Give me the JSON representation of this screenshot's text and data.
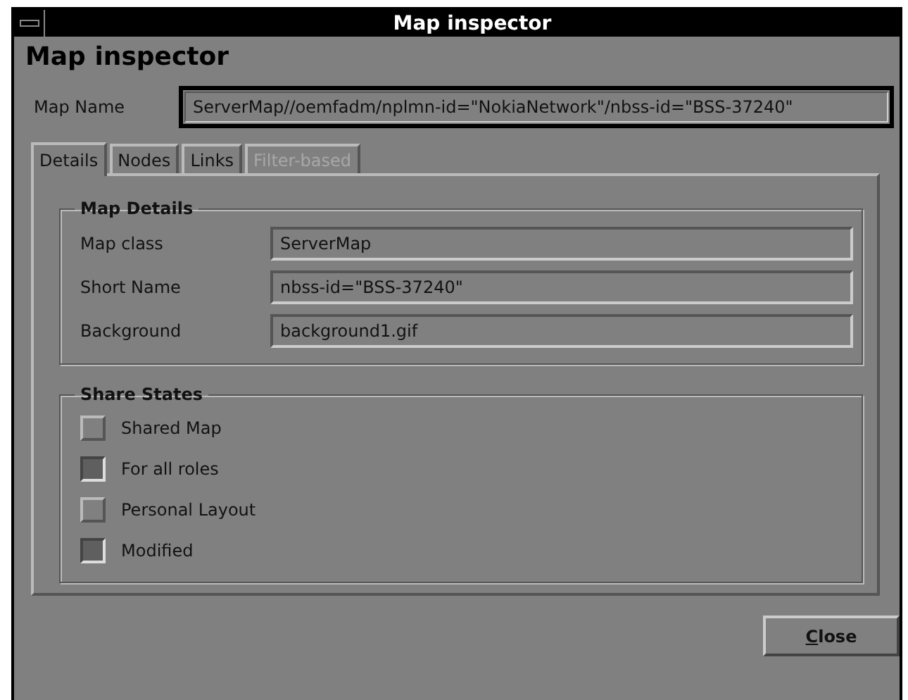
{
  "window": {
    "title": "Map inspector"
  },
  "heading": "Map inspector",
  "map_name": {
    "label": "Map Name",
    "value": "ServerMap//oemfadm/nplmn-id=\"NokiaNetwork\"/nbss-id=\"BSS-37240\""
  },
  "tabs": [
    {
      "label": "Details",
      "selected": true,
      "disabled": false
    },
    {
      "label": "Nodes",
      "selected": false,
      "disabled": false
    },
    {
      "label": "Links",
      "selected": false,
      "disabled": false
    },
    {
      "label": "Filter-based",
      "selected": false,
      "disabled": true
    }
  ],
  "map_details": {
    "title": "Map Details",
    "fields": [
      {
        "label": "Map class",
        "value": "ServerMap"
      },
      {
        "label": "Short Name",
        "value": "nbss-id=\"BSS-37240\""
      },
      {
        "label": "Background",
        "value": "background1.gif"
      }
    ]
  },
  "share_states": {
    "title": "Share States",
    "items": [
      {
        "label": "Shared Map",
        "checked": false
      },
      {
        "label": "For all roles",
        "checked": true
      },
      {
        "label": "Personal Layout",
        "checked": false
      },
      {
        "label": "Modified",
        "checked": true
      }
    ]
  },
  "buttons": [
    {
      "label": "Close"
    }
  ]
}
